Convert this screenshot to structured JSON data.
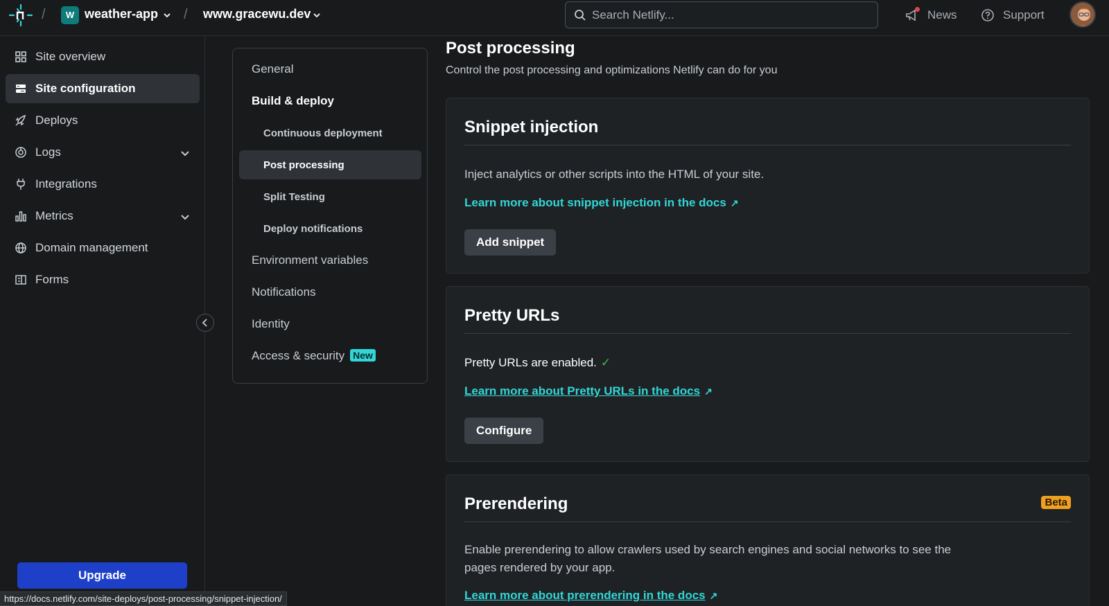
{
  "topbar": {
    "site_badge": "W",
    "site_name": "weather-app",
    "domain": "www.gracewu.dev",
    "search_placeholder": "Search Netlify...",
    "news_label": "News",
    "support_label": "Support"
  },
  "sidebar": {
    "items": [
      {
        "label": "Site overview"
      },
      {
        "label": "Site configuration"
      },
      {
        "label": "Deploys"
      },
      {
        "label": "Logs"
      },
      {
        "label": "Integrations"
      },
      {
        "label": "Metrics"
      },
      {
        "label": "Domain management"
      },
      {
        "label": "Forms"
      }
    ],
    "upgrade_label": "Upgrade"
  },
  "status_url": "https://docs.netlify.com/site-deploys/post-processing/snippet-injection/",
  "subnav": {
    "items": [
      {
        "label": "General"
      },
      {
        "label": "Build & deploy"
      },
      {
        "label": "Continuous deployment"
      },
      {
        "label": "Post processing"
      },
      {
        "label": "Split Testing"
      },
      {
        "label": "Deploy notifications"
      },
      {
        "label": "Environment variables"
      },
      {
        "label": "Notifications"
      },
      {
        "label": "Identity"
      },
      {
        "label": "Access & security"
      }
    ],
    "new_badge": "New"
  },
  "main": {
    "title": "Post processing",
    "subtitle": "Control the post processing and optimizations Netlify can do for you",
    "cards": [
      {
        "title": "Snippet injection",
        "text": "Inject analytics or other scripts into the HTML of your site.",
        "link": "Learn more about snippet injection in the docs",
        "button": "Add snippet"
      },
      {
        "title": "Pretty URLs",
        "text": "Pretty URLs are enabled.",
        "link": "Learn more about Pretty URLs in the docs",
        "button": "Configure"
      },
      {
        "title": "Prerendering",
        "badge": "Beta",
        "text": "Enable prerendering to allow crawlers used by search engines and social networks to see the pages rendered by your app.",
        "link": "Learn more about prerendering in the docs"
      }
    ]
  },
  "colors": {
    "accent_teal": "#32d6d6",
    "upgrade_blue": "#1e40c8",
    "beta_orange": "#f0a020",
    "check_green": "#3fb950"
  },
  "icons": {
    "logo": "netlify-logo",
    "search": "search-icon",
    "news": "megaphone-icon",
    "support": "help-circle-icon",
    "arrow": "external-arrow-icon",
    "check": "check-icon"
  }
}
